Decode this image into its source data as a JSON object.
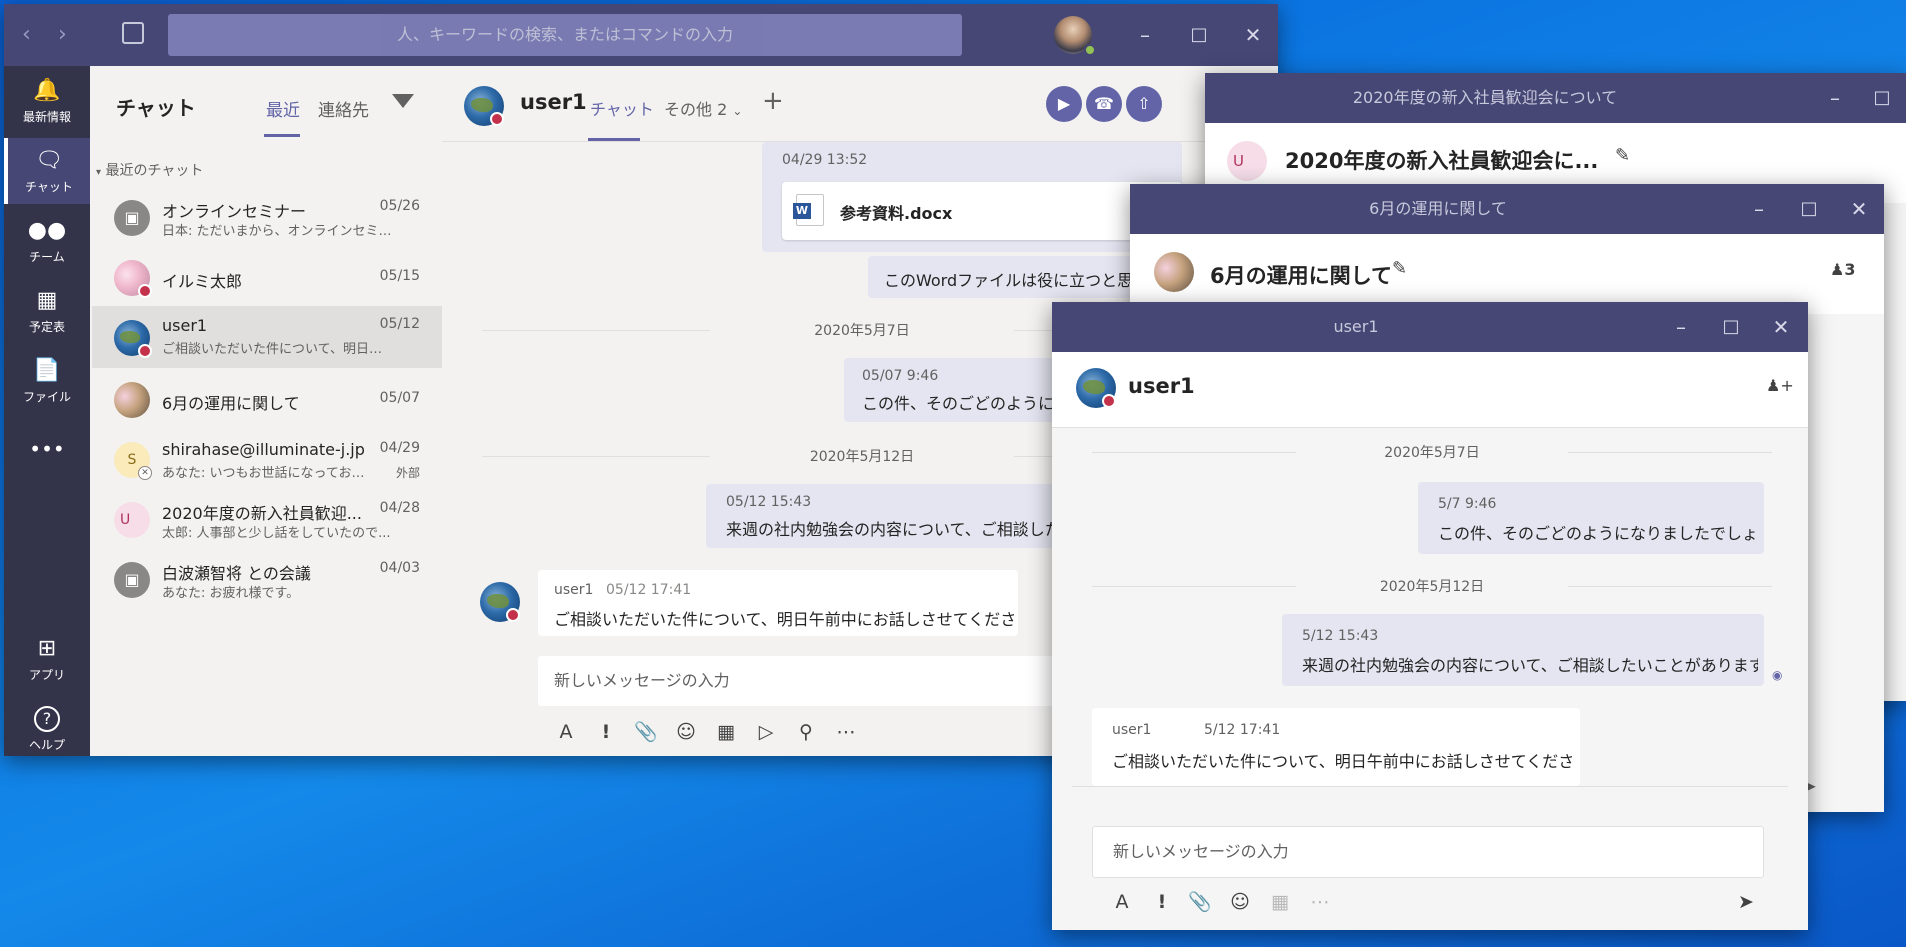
{
  "main": {
    "search_placeholder": "人、キーワードの検索、またはコマンドの入力",
    "rail": [
      {
        "label": "最新情報",
        "icon": "bell-icon"
      },
      {
        "label": "チャット",
        "icon": "chat-icon"
      },
      {
        "label": "チーム",
        "icon": "teams-icon"
      },
      {
        "label": "予定表",
        "icon": "calendar-icon"
      },
      {
        "label": "ファイル",
        "icon": "file-icon"
      },
      {
        "label": "アプリ",
        "icon": "apps-icon"
      },
      {
        "label": "ヘルプ",
        "icon": "help-icon"
      }
    ],
    "chat_panel": {
      "title": "チャット",
      "tab_recent": "最近",
      "tab_contacts": "連絡先",
      "section": "最近のチャット",
      "items": [
        {
          "name": "オンラインセミナー",
          "preview": "日本: ただいまから、オンラインセミナー...",
          "date": "05/26",
          "badge": "",
          "avatar_text": "",
          "avatar_type": "gray"
        },
        {
          "name": "イルミ太郎",
          "preview": "",
          "date": "05/15",
          "badge": "",
          "avatar_text": "",
          "avatar_type": "flower"
        },
        {
          "name": "user1",
          "preview": "ご相談いただいた件について、明日午...",
          "date": "05/12",
          "badge": "",
          "avatar_text": "",
          "avatar_type": "globe"
        },
        {
          "name": "6月の運用に関して",
          "preview": "",
          "date": "05/07",
          "badge": "",
          "avatar_text": "",
          "avatar_type": "group"
        },
        {
          "name": "shirahase@illuminate-j.jp",
          "preview": "あなた: いつもお世話になっておりま...",
          "date": "04/29",
          "badge": "外部",
          "avatar_text": "S",
          "avatar_type": "yellow"
        },
        {
          "name": "2020年度の新入社員歓迎...",
          "preview": "太郎: 人事部と少し話をしていたので...",
          "date": "04/28",
          "badge": "",
          "avatar_text": "U",
          "avatar_type": "u"
        },
        {
          "name": "白波瀬智将 との会議",
          "preview": "あなた: お疲れ様です。",
          "date": "04/03",
          "badge": "",
          "avatar_text": "",
          "avatar_type": "gray"
        }
      ]
    },
    "conv": {
      "name": "user1",
      "tab_chat": "チャット",
      "tab_more": "その他 2",
      "file_time": "04/29 13:52",
      "file_name": "参考資料.docx",
      "msg_word": "このWordファイルは役に立つと思いま",
      "date1": "2020年5月7日",
      "m1_time": "05/07 9:46",
      "m1_text": "この件、そのごどのようになりま",
      "date2": "2020年5月12日",
      "m2_time": "05/12 15:43",
      "m2_text": "来週の社内勉強会の内容について、ご相談した",
      "m3_sender": "user1",
      "m3_time": "05/12 17:41",
      "m3_text": "ご相談いただいた件について、明日午前中にお話しさせてください。",
      "compose": "新しいメッセージの入力"
    }
  },
  "win_welcome": {
    "title": "2020年度の新入社員歓迎会について",
    "header": "2020年度の新入社員歓迎会に..."
  },
  "win_june": {
    "title": "6月の運用に関して",
    "header": "6月の運用に関して",
    "participants": "3"
  },
  "win_user1": {
    "title": "user1",
    "header": "user1",
    "date1": "2020年5月7日",
    "m1_time": "5/7 9:46",
    "m1_text": "この件、そのごどのようになりましたでしょうか？",
    "date2": "2020年5月12日",
    "m2_time": "5/12 15:43",
    "m2_text": "来週の社内勉強会の内容について、ご相談したいことがあります。",
    "m3_sender": "user1",
    "m3_time": "5/12 17:41",
    "m3_text": "ご相談いただいた件について、明日午前中にお話しさせてください。",
    "compose": "新しいメッセージの入力"
  },
  "colors": {
    "accent": "#6264a7",
    "titlebar": "#464775",
    "rail": "#33344a",
    "busy": "#c4314b"
  }
}
